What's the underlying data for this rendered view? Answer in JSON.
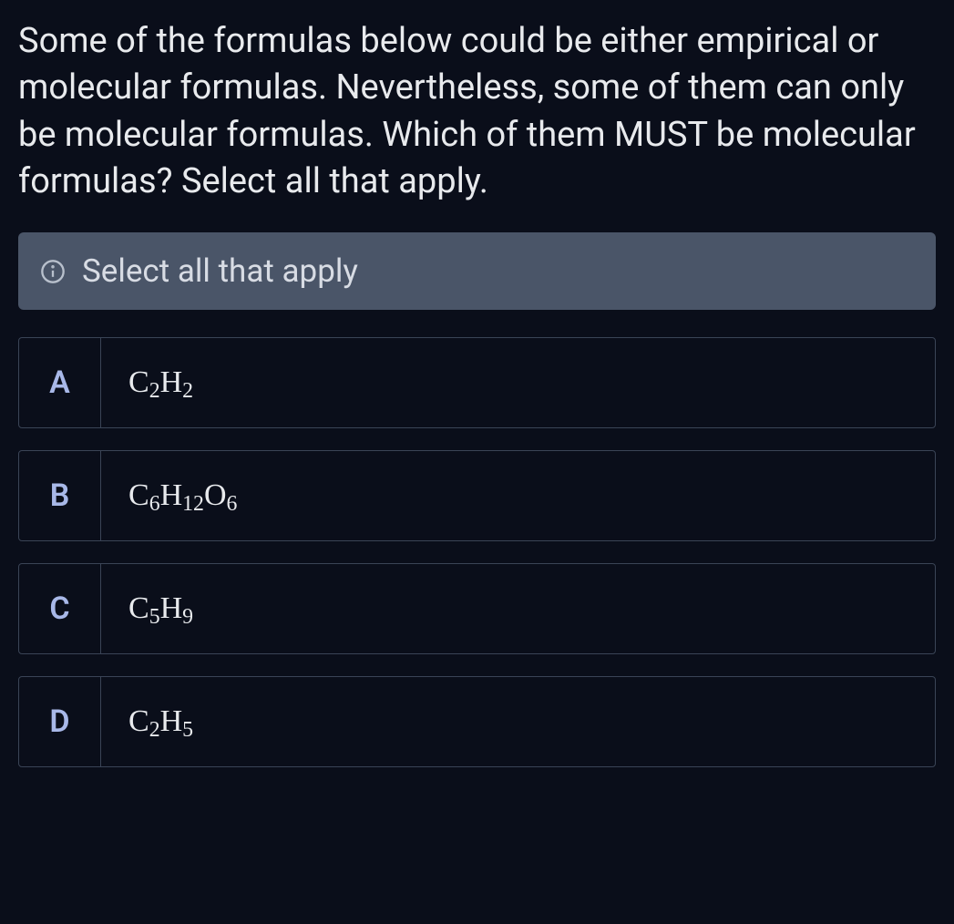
{
  "question": "Some of the formulas below could be either empirical or molecular formulas. Nevertheless, some of them can only be molecular formulas. Which of them MUST be molecular formulas? Select all that apply.",
  "banner": {
    "text": "Select all that apply"
  },
  "options": [
    {
      "letter": "A",
      "formula_parts": [
        {
          "base": "C",
          "sub": "2"
        },
        {
          "base": "H",
          "sub": "2"
        }
      ]
    },
    {
      "letter": "B",
      "formula_parts": [
        {
          "base": "C",
          "sub": "6"
        },
        {
          "base": "H",
          "sub": "12"
        },
        {
          "base": "O",
          "sub": "6"
        }
      ]
    },
    {
      "letter": "C",
      "formula_parts": [
        {
          "base": "C",
          "sub": "5"
        },
        {
          "base": "H",
          "sub": "9"
        }
      ]
    },
    {
      "letter": "D",
      "formula_parts": [
        {
          "base": "C",
          "sub": "2"
        },
        {
          "base": "H",
          "sub": "5"
        }
      ]
    }
  ]
}
